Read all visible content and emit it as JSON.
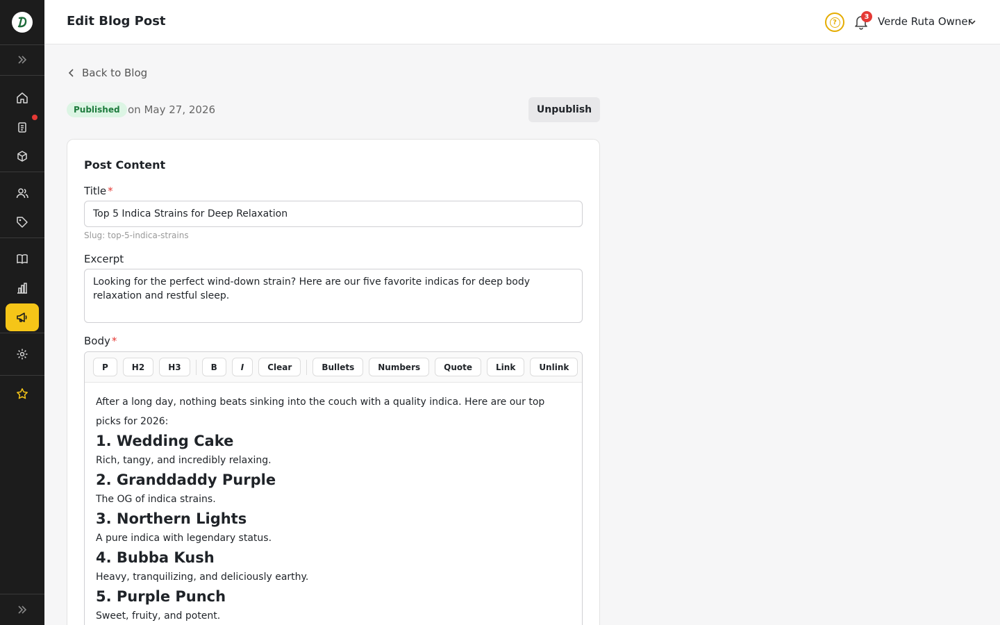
{
  "header": {
    "title": "Edit Blog Post",
    "notification_count": "3",
    "user_name": "Verde Ruta Owner"
  },
  "sidebar": {
    "items": [
      {
        "icon": "home-icon"
      },
      {
        "icon": "clipboard-icon"
      },
      {
        "icon": "box-icon"
      },
      {
        "icon": "users-icon"
      },
      {
        "icon": "tag-icon"
      },
      {
        "icon": "book-icon"
      },
      {
        "icon": "chart-icon"
      },
      {
        "icon": "megaphone-icon",
        "active": true
      },
      {
        "icon": "settings-icon"
      },
      {
        "icon": "star-icon"
      }
    ]
  },
  "nav": {
    "back_label": "Back to Blog"
  },
  "status": {
    "badge": "Published",
    "date": "on May 27, 2026",
    "unpublish_label": "Unpublish"
  },
  "card": {
    "title": "Post Content",
    "title_label": "Title",
    "required_mark": "*",
    "title_value": "Top 5 Indica Strains for Deep Relaxation",
    "slug": "Slug: top-5-indica-strains",
    "excerpt_label": "Excerpt",
    "excerpt_value": "Looking for the perfect wind-down strain? Here are our five favorite indicas for deep body relaxation and restful sleep.",
    "body_label": "Body"
  },
  "toolbar": {
    "p": "P",
    "h2": "H2",
    "h3": "H3",
    "bold": "B",
    "italic": "I",
    "clear": "Clear",
    "bullets": "Bullets",
    "numbers": "Numbers",
    "quote": "Quote",
    "link": "Link",
    "unlink": "Unlink"
  },
  "editor": {
    "intro": "After a long day, nothing beats sinking into the couch with a quality indica. Here are our top picks for 2026:",
    "sections": [
      {
        "heading": "1. Wedding Cake",
        "text": "Rich, tangy, and incredibly relaxing."
      },
      {
        "heading": "2. Granddaddy Purple",
        "text": "The OG of indica strains."
      },
      {
        "heading": "3. Northern Lights",
        "text": "A pure indica with legendary status."
      },
      {
        "heading": "4. Bubba Kush",
        "text": "Heavy, tranquilizing, and deliciously earthy."
      },
      {
        "heading": "5. Purple Punch",
        "text": "Sweet, fruity, and potent."
      }
    ]
  },
  "colors": {
    "sidebar_bg": "#1c1c1c",
    "accent": "#f5c518",
    "published_bg": "#dcf5e4",
    "published_text": "#1e7b3d",
    "danger": "#e53935"
  }
}
